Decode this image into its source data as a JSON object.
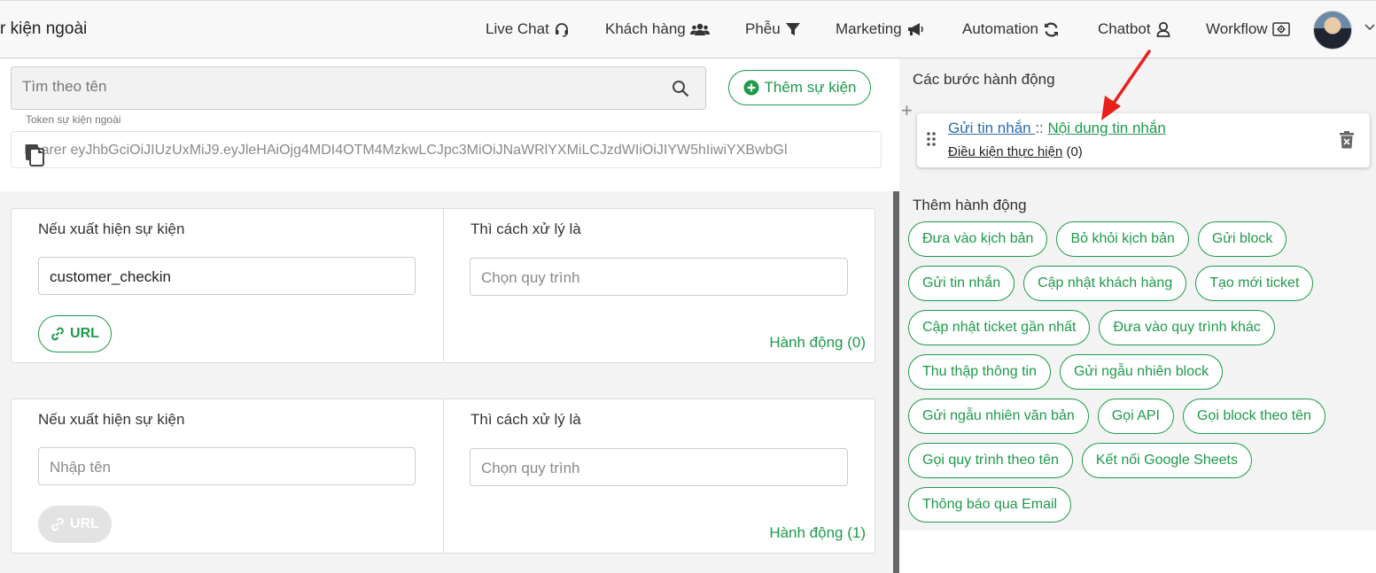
{
  "header": {
    "page_title": "r kiện ngoài",
    "nav": {
      "livechat": "Live Chat",
      "customers": "Khách hàng",
      "funnel": "Phễu",
      "marketing": "Marketing",
      "automation": "Automation",
      "chatbot": "Chatbot",
      "workflow": "Workflow"
    },
    "icons": [
      "headset-icon",
      "users-icon",
      "filter-icon",
      "megaphone-icon",
      "sync-icon",
      "robot-icon",
      "workflow-icon",
      "chevron-down-icon"
    ]
  },
  "search": {
    "placeholder": "Tìm theo tên",
    "value": ""
  },
  "add_event_button": "Thêm sự kiện",
  "token": {
    "label": "Token sự kiện ngoài",
    "value": "Bearer eyJhbGciOiJIUzUxMiJ9.eyJleHAiOjg4MDI4OTM4MzkwLCJpc3MiOiJNaWRlYXMiLCJzdWIiOiJIYW5hIiwiYXBwbGl"
  },
  "events": [
    {
      "condition_heading": "Nếu xuất hiện sự kiện",
      "event_name": "customer_checkin",
      "event_placeholder": "Nhập tên",
      "url_label": "URL",
      "handler_heading": "Thì cách xử lý là",
      "workflow_placeholder": "Chọn quy trình",
      "actions_label": "Hành động (0)"
    },
    {
      "condition_heading": "Nếu xuất hiện sự kiện",
      "event_name": "",
      "event_placeholder": "Nhập tên",
      "url_label": "URL",
      "handler_heading": "Thì cách xử lý là",
      "workflow_placeholder": "Chọn quy trình",
      "actions_label": "Hành động (1)"
    }
  ],
  "steps": {
    "title": "Các bước hành động",
    "plus": "+",
    "items": [
      {
        "action": "Gửi tin nhắn ",
        "separator": "::",
        "content": "Nội dung tin nhắn",
        "condition_label": "Điều kiện thực hiện",
        "condition_count": "(0)"
      }
    ]
  },
  "add_action": {
    "title": "Thêm hành động",
    "chips": [
      "Đưa vào kịch bản",
      "Bỏ khỏi kịch bản",
      "Gửi block",
      "Gửi tin nhắn",
      "Cập nhật khách hàng",
      "Tạo mới ticket",
      "Cập nhật ticket gần nhất",
      "Đưa vào quy trình khác",
      "Thu thập thông tin",
      "Gửi ngẫu nhiên block",
      "Gửi ngẫu nhiên văn bản",
      "Gọi API",
      "Gọi block theo tên",
      "Gọi quy trình theo tên",
      "Kết nối Google Sheets",
      "Thông báo qua Email"
    ]
  },
  "colors": {
    "accent_green": "#1d9a4a",
    "link_blue": "#2b6cb0",
    "annotation_red": "#e8201c"
  }
}
